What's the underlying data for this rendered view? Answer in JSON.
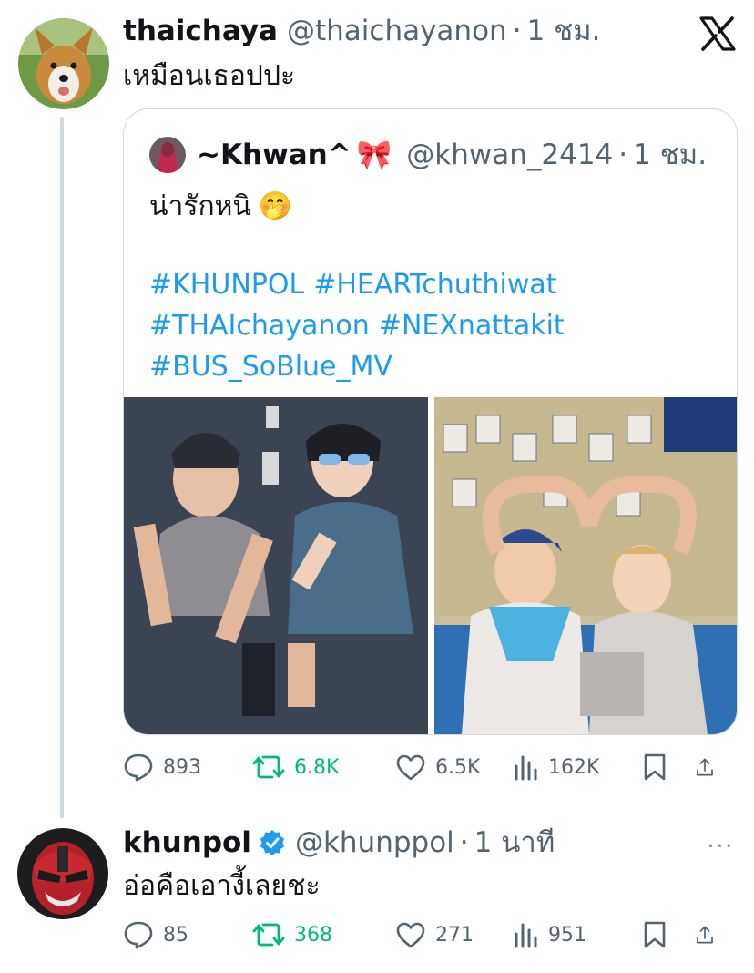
{
  "tweet": {
    "name": "thaichaya",
    "handle": "@thaichayanon",
    "separator": "·",
    "time": "1 ชม.",
    "text": "เหมือนเธอปปะ",
    "stats": {
      "replies": "893",
      "retweets": "6.8K",
      "likes": "6.5K",
      "views": "162K"
    }
  },
  "quote": {
    "name": "~Khwan^",
    "bow_emoji": "🎀",
    "handle": "@khwan_2414",
    "separator": "·",
    "time": "1 ชม.",
    "text": "น่ารักหนิ",
    "emoji": "🤭",
    "hashtags": [
      "#KHUNPOL",
      "#HEARTchuthiwat",
      "#THAIchayanon",
      "#NEXnattakit",
      "#BUS_SoBlue_MV"
    ]
  },
  "reply": {
    "name": "khunpol",
    "handle": "@khunppol",
    "separator": "·",
    "time": "1 นาที",
    "text": "อ่อคือเอางี้เลยชะ",
    "more": "···",
    "stats": {
      "replies": "85",
      "retweets": "368",
      "likes": "271",
      "views": "951"
    }
  },
  "colors": {
    "retweet": "#00ba7c",
    "hashtag": "#1d9bf0",
    "verified": "#1d9bf0",
    "muted": "#536471"
  },
  "icons": [
    "x-logo-icon",
    "reply-icon",
    "retweet-icon",
    "like-icon",
    "views-icon",
    "bookmark-icon",
    "share-icon",
    "verified-icon",
    "more-icon"
  ]
}
